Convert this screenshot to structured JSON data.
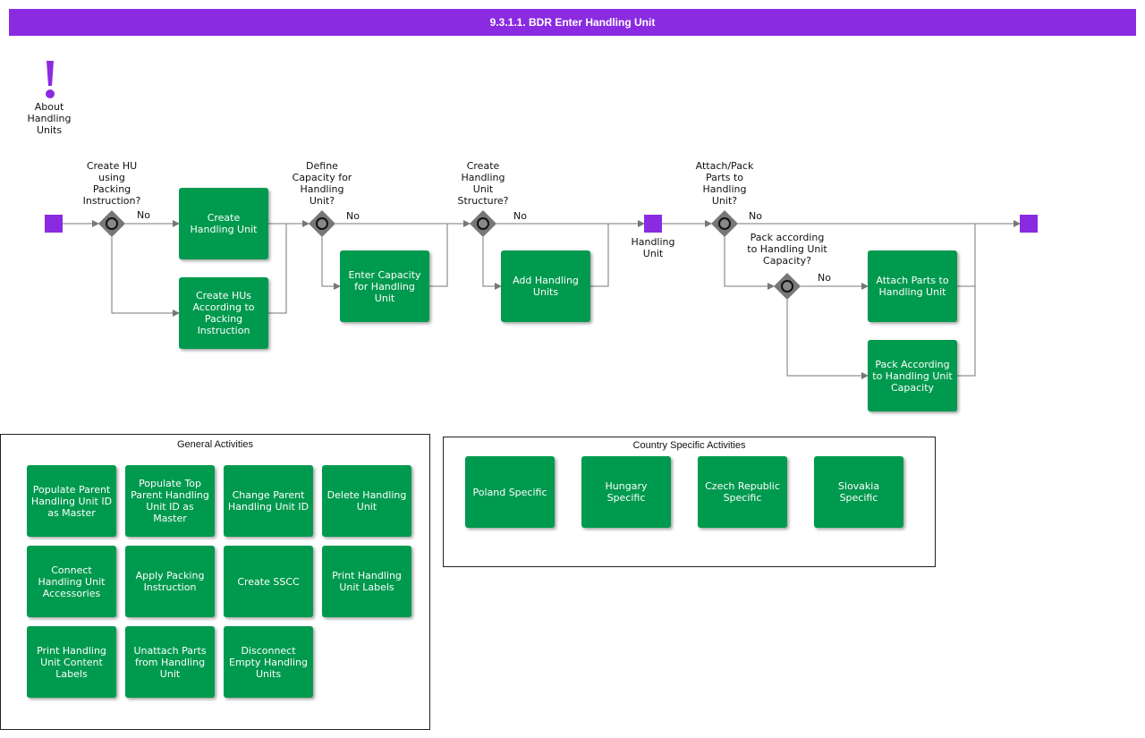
{
  "title": "9.3.1.1. BDR Enter Handling Unit",
  "note": {
    "icon": "exclamation-icon",
    "label": "About\nHandling\nUnits"
  },
  "gateways": {
    "g1": "Create HU\nusing\nPacking\nInstruction?",
    "g2": "Define\nCapacity for\nHandling\nUnit?",
    "g3": "Create\nHandling\nUnit\nStructure?",
    "g4": "Attach/Pack\nParts to\nHandling\nUnit?",
    "g5": "Pack according\nto Handling Unit\nCapacity?"
  },
  "no_label": "No",
  "intermediate_event_label": "Handling\nUnit",
  "tasks": {
    "create_hu": "Create\nHandling Unit",
    "create_hus_packing": "Create HUs\nAccording to\nPacking\nInstruction",
    "enter_capacity": "Enter Capacity\nfor Handling Unit",
    "add_hus": "Add Handling\nUnits",
    "attach_parts": "Attach Parts to\nHandling Unit",
    "pack_according": "Pack According\nto Handling Unit\nCapacity"
  },
  "general": {
    "title": "General Activities",
    "items": [
      "Populate Parent\nHandling Unit ID\nas Master",
      "Populate Top\nParent Handling\nUnit ID as\nMaster",
      "Change Parent\nHandling Unit ID",
      "Delete Handling\nUnit",
      "Connect\nHandling Unit\nAccessories",
      "Apply Packing\nInstruction",
      "Create SSCC",
      "Print Handling\nUnit Labels",
      "Print Handling\nUnit Content\nLabels",
      "Unattach Parts\nfrom Handling\nUnit",
      "Disconnect\nEmpty Handling\nUnits"
    ]
  },
  "country": {
    "title": "Country Specific Activities",
    "items": [
      "Poland Specific",
      "Hungary Specific",
      "Czech Republic\nSpecific",
      "Slovakia\nSpecific"
    ]
  },
  "colors": {
    "accent": "#8a2be2",
    "task": "#009a4e",
    "gateway": "#777777",
    "connector": "#777777"
  }
}
